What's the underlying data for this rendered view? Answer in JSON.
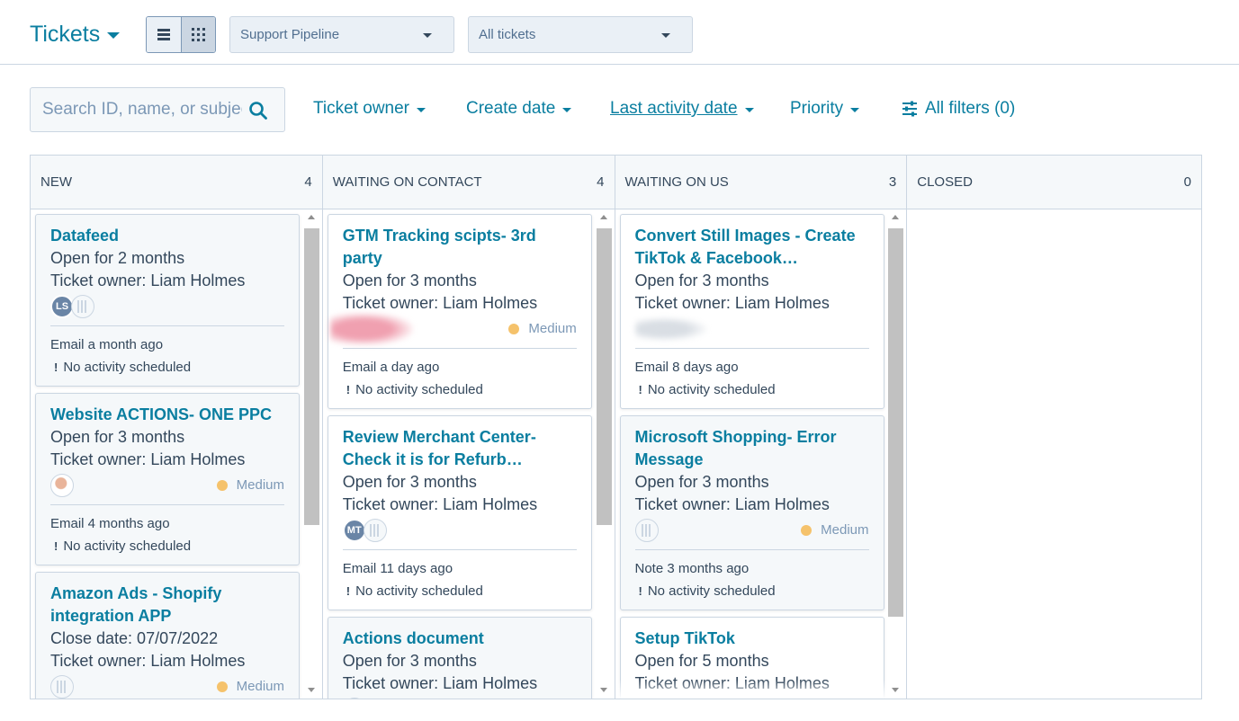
{
  "header": {
    "title": "Tickets",
    "pipeline": "Support Pipeline",
    "view": "All tickets"
  },
  "filters": {
    "search_placeholder": "Search ID, name, or subject",
    "ticket_owner": "Ticket owner",
    "create_date": "Create date",
    "last_activity_date": "Last activity date",
    "priority": "Priority",
    "all_filters": "All filters (0)"
  },
  "colors": {
    "accent": "#0a7ea0",
    "text": "#33475b",
    "border": "#cbd6e2",
    "card_bg": "#f5f8fa",
    "priority_medium": "#f5c26b"
  },
  "columns": [
    {
      "name": "NEW",
      "count": "4",
      "cards": [
        {
          "title": "Datafeed",
          "line1": "Open for 2 months",
          "owner_label": "Ticket owner:",
          "owner": "Liam Holmes",
          "avatar_initials": "LS",
          "activity": "Email a month ago",
          "next": "No activity scheduled"
        },
        {
          "title": "Website ACTIONS- ONE PPC",
          "line1": "Open for 3 months",
          "owner_label": "Ticket owner:",
          "owner": "Liam Holmes",
          "priority": "Medium",
          "activity": "Email 4 months ago",
          "next": "No activity scheduled"
        },
        {
          "title": "Amazon Ads - Shopify integration APP",
          "line1": "Close date: 07/07/2022",
          "owner_label": "Ticket owner:",
          "owner": "Liam Holmes",
          "priority": "Medium"
        }
      ]
    },
    {
      "name": "WAITING ON CONTACT",
      "count": "4",
      "cards": [
        {
          "title": "GTM Tracking scipts- 3rd party",
          "line1": "Open for 3 months",
          "owner_label": "Ticket owner:",
          "owner": "Liam Holmes",
          "priority": "Medium",
          "activity": "Email a day ago",
          "next": "No activity scheduled"
        },
        {
          "title": "Review Merchant Center- Check it is for Refurb…",
          "line1": "Open for 3 months",
          "owner_label": "Ticket owner:",
          "owner": "Liam Holmes",
          "avatar_initials": "MT",
          "activity": "Email 11 days ago",
          "next": "No activity scheduled"
        },
        {
          "title": "Actions document",
          "line1": "Open for 3 months",
          "owner_label": "Ticket owner:",
          "owner": "Liam Holmes"
        }
      ]
    },
    {
      "name": "WAITING ON US",
      "count": "3",
      "cards": [
        {
          "title": "Convert Still Images - Create TikTok & Facebook…",
          "line1": "Open for 3 months",
          "owner_label": "Ticket owner:",
          "owner": "Liam Holmes",
          "activity": "Email 8 days ago",
          "next": "No activity scheduled"
        },
        {
          "title": "Microsoft Shopping- Error Message",
          "line1": "Open for 3 months",
          "owner_label": "Ticket owner:",
          "owner": "Liam Holmes",
          "priority": "Medium",
          "activity": "Note 3 months ago",
          "next": "No activity scheduled"
        },
        {
          "title": "Setup TikTok",
          "line1": "Open for 5 months",
          "owner_label": "Ticket owner:",
          "owner": "Liam Holmes"
        }
      ]
    },
    {
      "name": "CLOSED",
      "count": "0",
      "cards": []
    }
  ]
}
